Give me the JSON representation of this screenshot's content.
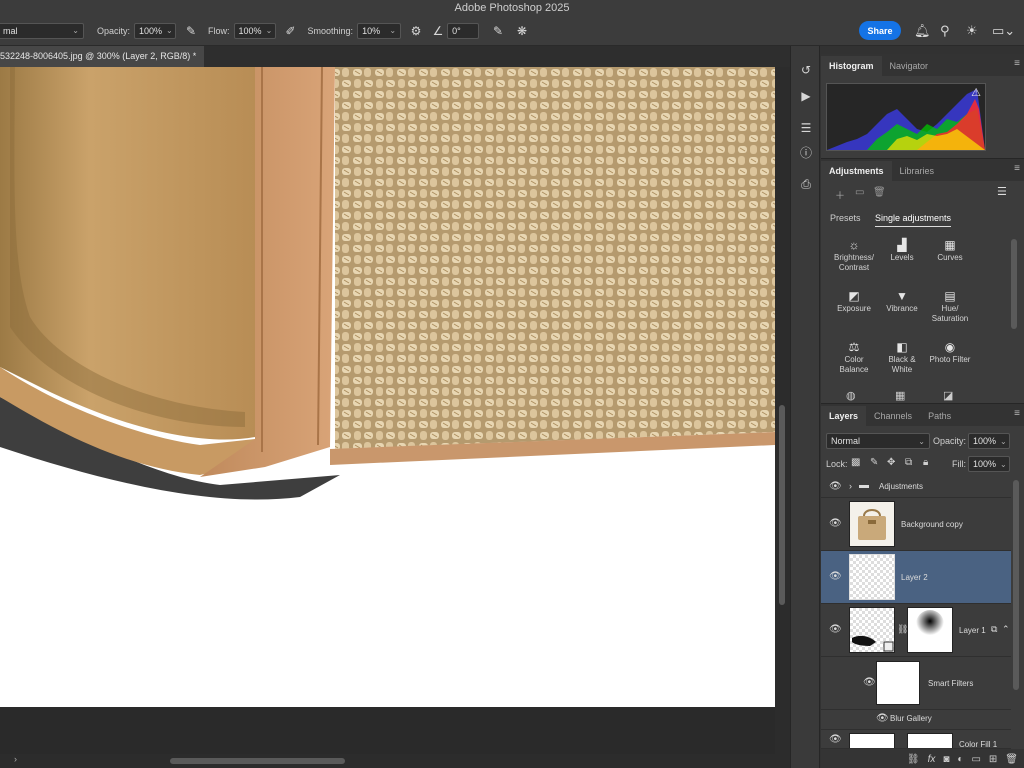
{
  "app": {
    "title": "Adobe Photoshop 2025"
  },
  "options_bar": {
    "mode_value": "mal",
    "opacity_label": "Opacity:",
    "opacity_value": "100%",
    "flow_label": "Flow:",
    "flow_value": "100%",
    "smoothing_label": "Smoothing:",
    "smoothing_value": "10%",
    "angle_value": "0°",
    "share_label": "Share"
  },
  "document": {
    "tab_title": "532248-8006405.jpg @ 300% (Layer 2, RGB/8) *"
  },
  "histogram_panel": {
    "tabs": [
      "Histogram",
      "Navigator"
    ],
    "active_tab": 0
  },
  "adjustments_panel": {
    "tabs": [
      "Adjustments",
      "Libraries"
    ],
    "subtabs": [
      "Presets",
      "Single adjustments"
    ],
    "items": [
      {
        "label1": "Brightness/",
        "label2": "Contrast",
        "icon": "brightness-contrast-icon",
        "glyph": "☼"
      },
      {
        "label1": "Levels",
        "label2": "",
        "icon": "levels-icon",
        "glyph": "▟"
      },
      {
        "label1": "Curves",
        "label2": "",
        "icon": "curves-icon",
        "glyph": "▦"
      },
      {
        "label1": "Exposure",
        "label2": "",
        "icon": "exposure-icon",
        "glyph": "◩"
      },
      {
        "label1": "Vibrance",
        "label2": "",
        "icon": "vibrance-icon",
        "glyph": "▼"
      },
      {
        "label1": "Hue/",
        "label2": "Saturation",
        "icon": "hue-saturation-icon",
        "glyph": "▤"
      },
      {
        "label1": "Color",
        "label2": "Balance",
        "icon": "color-balance-icon",
        "glyph": "⚖"
      },
      {
        "label1": "Black &",
        "label2": "White",
        "icon": "black-white-icon",
        "glyph": "◧"
      },
      {
        "label1": "Photo Filter",
        "label2": "",
        "icon": "photo-filter-icon",
        "glyph": "◉"
      }
    ]
  },
  "layers_panel": {
    "tabs": [
      "Layers",
      "Channels",
      "Paths"
    ],
    "blend_mode": "Normal",
    "opacity_label": "Opacity:",
    "opacity_value": "100%",
    "lock_label": "Lock:",
    "fill_label": "Fill:",
    "fill_value": "100%",
    "layers": [
      {
        "name": "Adjustments",
        "type": "group"
      },
      {
        "name": "Background copy",
        "type": "image"
      },
      {
        "name": "Layer 2",
        "type": "pixel",
        "selected": true
      },
      {
        "name": "Layer 1",
        "type": "masked"
      },
      {
        "name": "Smart Filters",
        "type": "smart-filter"
      },
      {
        "name": "Blur Gallery",
        "type": "filter"
      },
      {
        "name": "Color Fill 1",
        "type": "fill"
      }
    ]
  },
  "colors": {
    "accent": "#1473e6",
    "selected_layer": "#4a6282",
    "panel_bg": "#3c3c3c"
  }
}
